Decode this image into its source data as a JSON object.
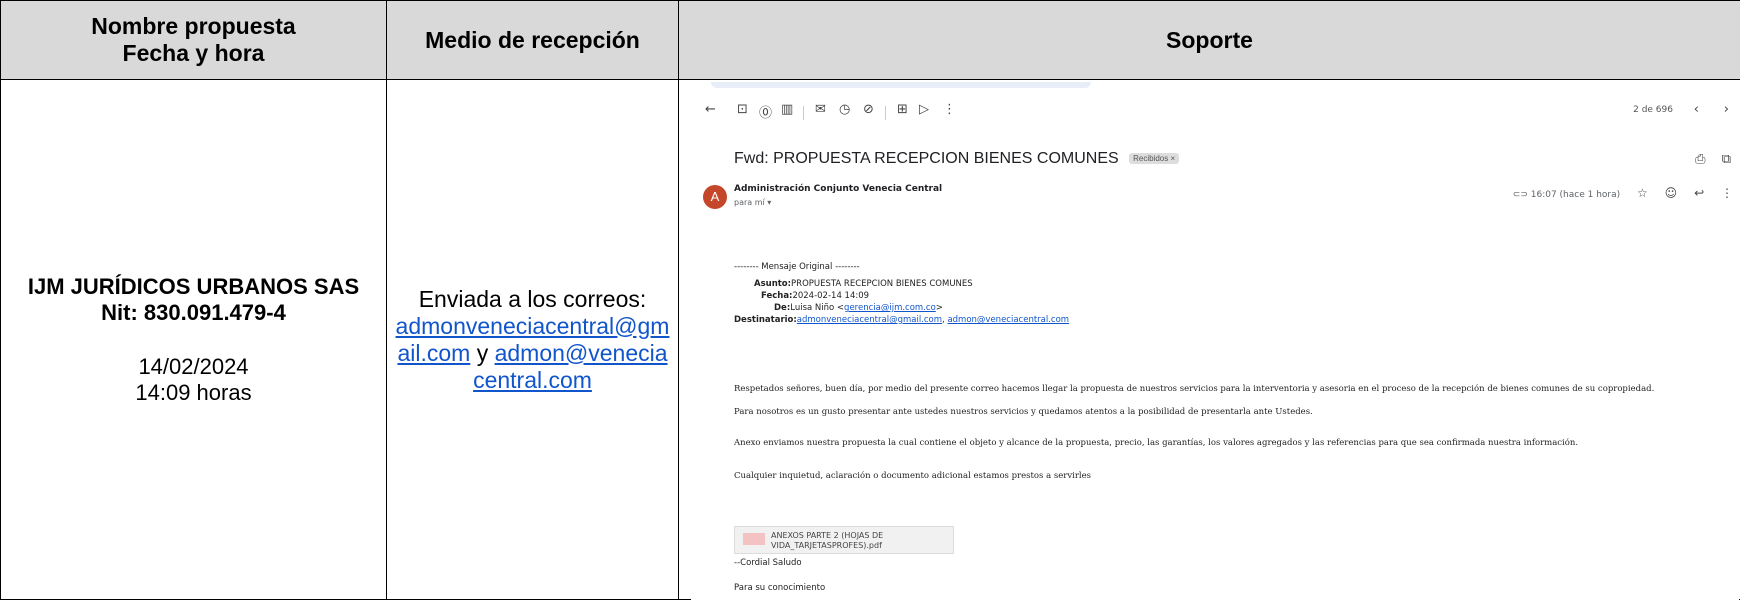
{
  "headers": {
    "col1_line1": "Nombre propuesta",
    "col1_line2": "Fecha y hora",
    "col2": "Medio de recepción",
    "col3": "Soporte"
  },
  "row": {
    "company_name": "IJM JURÍDICOS URBANOS SAS",
    "nit": "Nit: 830.091.479-4",
    "date": "14/02/2024",
    "time": "14:09 horas",
    "medio_intro": "Enviada a los correos:",
    "email1": "admonveneciacentral@gmail.com",
    "and_word": "y",
    "email2": "admon@veneciacentral.com"
  },
  "email": {
    "counter": "2 de 696",
    "subject": "Fwd: PROPUESTA RECEPCION BIENES COMUNES",
    "label_chip": "Recibidos ×",
    "avatar_letter": "A",
    "sender": "Administración Conjunto Venecia Central",
    "to_me": "para mí ▾",
    "time_meta": "16:07 (hace 1 hora)",
    "original_header": "-------- Mensaje Original --------",
    "asunto_label": "Asunto:",
    "asunto_value": "PROPUESTA RECEPCION BIENES COMUNES",
    "fecha_label": "Fecha:",
    "fecha_value": "2024-02-14 14:09",
    "de_label": "De:",
    "de_value": "Luisa Niño <",
    "de_email": "gerencia@ijm.com.co",
    "de_close": ">",
    "dest_label": "Destinatario:",
    "dest_email1": "admonveneciacentral@gmail.com",
    "dest_sep": ", ",
    "dest_email2": "admon@veneciacentral.com",
    "p1": "Respetados señores, buen día, por medio del presente correo hacemos llegar la propuesta de nuestros servicios para la interventoria y asesoria en el proceso de la recepción de bienes comunes de su copropiedad.",
    "p2": "Para nosotros es un gusto presentar ante ustedes nuestros servicios y quedamos atentos a la posibilidad de presentarla ante Ustedes.",
    "p3": "Anexo enviamos nuestra propuesta la cual contiene el objeto y alcance de la propuesta, precio, las garantías, los valores agregados y las referencias para que sea confirmada nuestra información.",
    "p4": "Cualquier inquietud, aclaración o documento adicional estamos prestos a servirles",
    "attachment": "ANEXOS PARTE 2 (HOJAS DE VIDA_TARJETASPROFES).pdf",
    "closing": "--Cordial Saludo",
    "footer": "Para su conocimiento"
  }
}
